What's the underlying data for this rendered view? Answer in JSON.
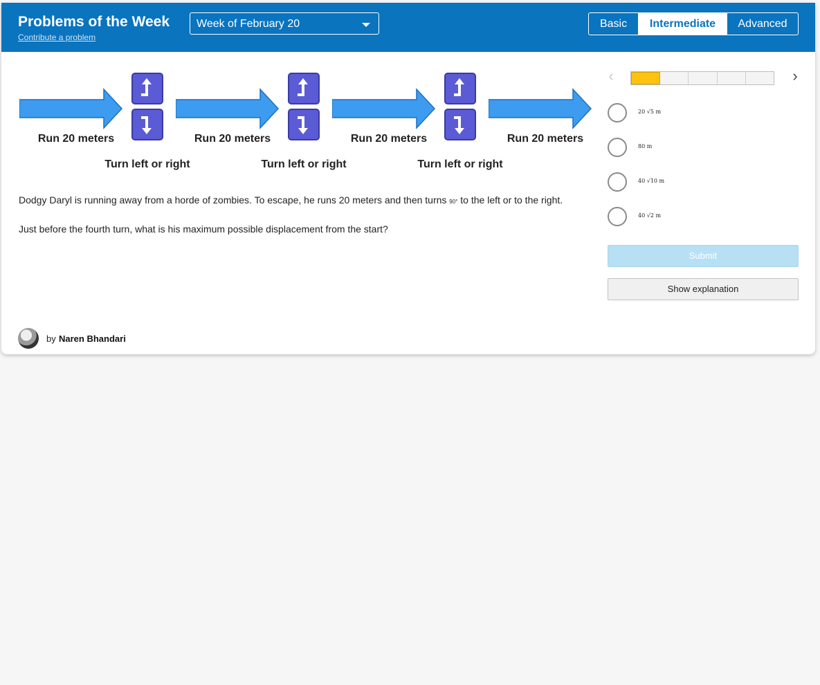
{
  "header": {
    "title": "Problems of the Week",
    "contribute_link": "Contribute a problem",
    "week_select": {
      "selected": "Week of February 20"
    },
    "levels": [
      "Basic",
      "Intermediate",
      "Advanced"
    ],
    "active_level": "Intermediate"
  },
  "colors": {
    "header_bg": "#0a74be",
    "arrow": "#3d9cf0",
    "turn_icon": "#5b5bd6",
    "progress_active": "#ffc20e",
    "submit_bg": "#b7e0f5"
  },
  "diagram": {
    "run_labels": [
      "Run 20 meters",
      "Run 20 meters",
      "Run 20 meters",
      "Run 20 meters"
    ],
    "turn_labels": [
      "Turn left or right",
      "Turn left or right",
      "Turn left or right"
    ],
    "icons": [
      "turn-up-right-icon",
      "turn-down-right-icon"
    ]
  },
  "question": {
    "line1_before": "Dodgy Daryl is running away from a horde of zombies. To escape, he runs 20 meters and then turns ",
    "line1_mini": "90°",
    "line1_after": " to the left or to the right.",
    "line2": "Just before the fourth turn, what is his maximum possible displacement from the start?"
  },
  "progress": {
    "segments": 5,
    "current": 1
  },
  "answers": [
    {
      "label": "20 √5 m"
    },
    {
      "label": "80 m"
    },
    {
      "label": "40 √10 m"
    },
    {
      "label": "40 √2 m"
    }
  ],
  "buttons": {
    "submit": "Submit",
    "explanation": "Show explanation"
  },
  "author": {
    "by": "by",
    "name": "Naren Bhandari"
  }
}
